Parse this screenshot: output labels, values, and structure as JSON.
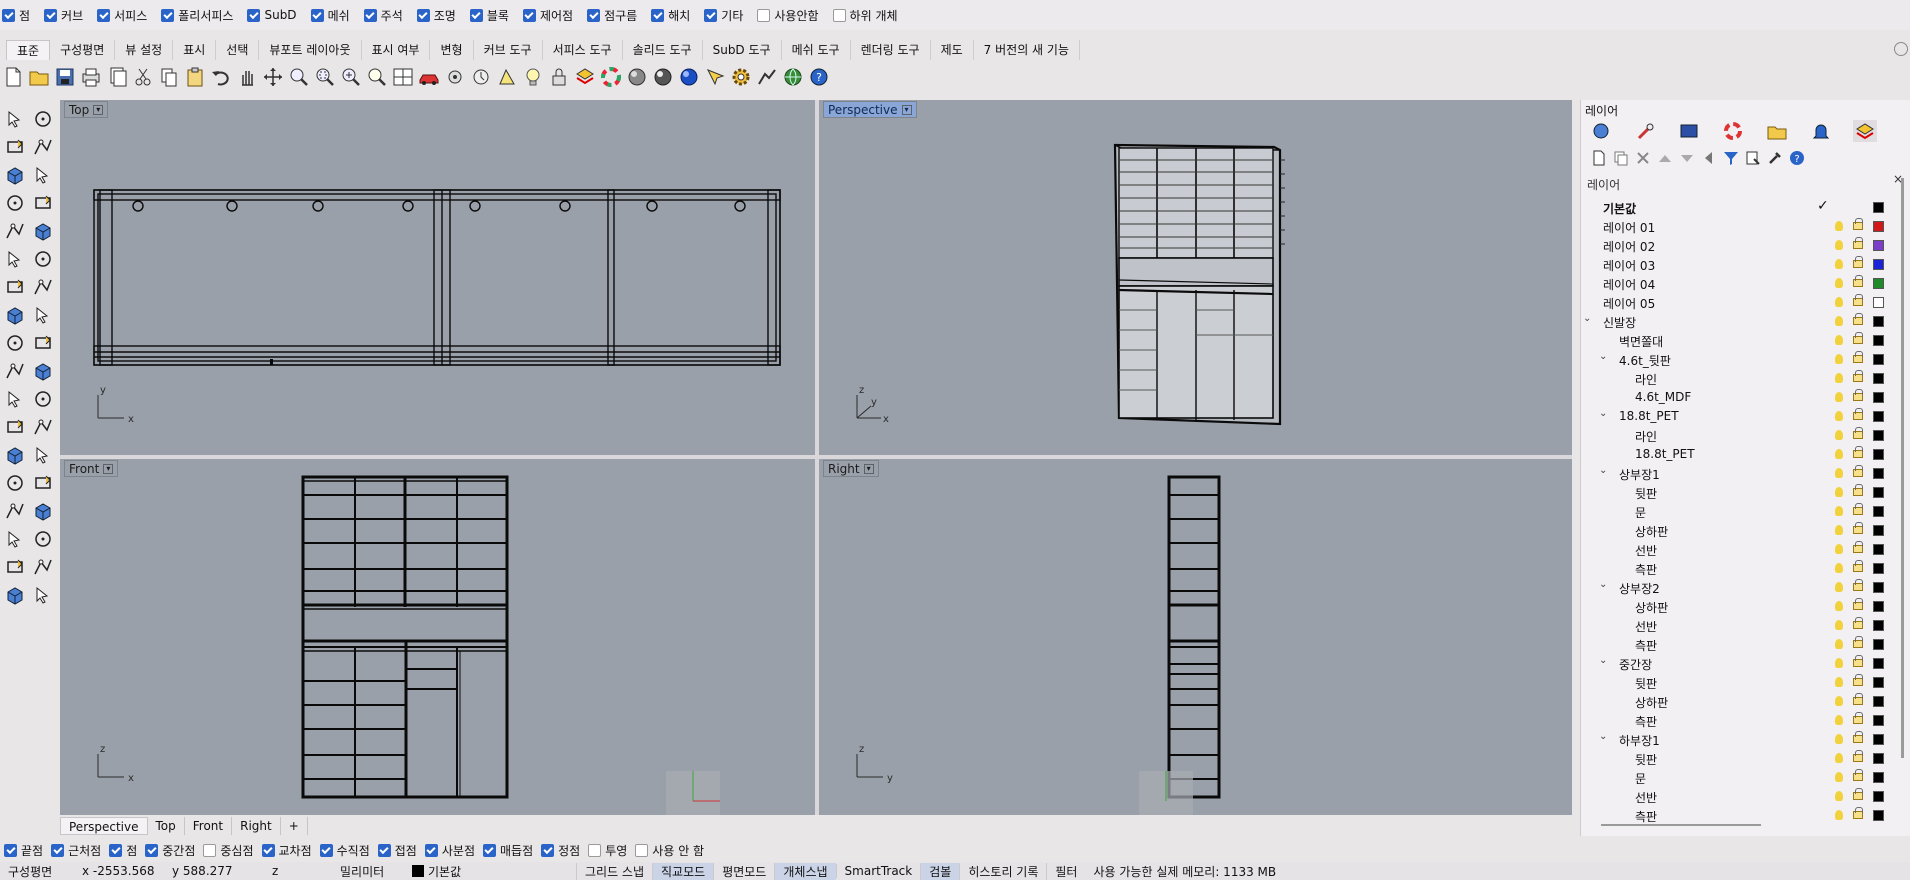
{
  "filters": [
    {
      "label": "점",
      "on": true
    },
    {
      "label": "커브",
      "on": true
    },
    {
      "label": "서피스",
      "on": true
    },
    {
      "label": "폴리서피스",
      "on": true
    },
    {
      "label": "SubD",
      "on": true
    },
    {
      "label": "메쉬",
      "on": true
    },
    {
      "label": "주석",
      "on": true
    },
    {
      "label": "조명",
      "on": true
    },
    {
      "label": "블록",
      "on": true
    },
    {
      "label": "제어점",
      "on": true
    },
    {
      "label": "점구름",
      "on": true
    },
    {
      "label": "해치",
      "on": true
    },
    {
      "label": "기타",
      "on": true
    },
    {
      "label": "사용안함",
      "on": false
    },
    {
      "label": "하위 개체",
      "on": false
    }
  ],
  "tabs": [
    "표준",
    "구성평면",
    "뷰 설정",
    "표시",
    "선택",
    "뷰포트 레이아웃",
    "표시 여부",
    "변형",
    "커브 도구",
    "서피스 도구",
    "솔리드 도구",
    "SubD 도구",
    "메쉬 도구",
    "렌더링 도구",
    "제도",
    "7 버전의 새 기능"
  ],
  "viewports": {
    "top": {
      "label": "Top"
    },
    "perspective": {
      "label": "Perspective"
    },
    "front": {
      "label": "Front"
    },
    "right": {
      "label": "Right"
    }
  },
  "axes": {
    "x": "x",
    "y": "y",
    "z": "z"
  },
  "viewport_tabs": [
    "Perspective",
    "Top",
    "Front",
    "Right",
    "+"
  ],
  "layer_panel": {
    "title": "레이어",
    "header": "레이어",
    "rows": [
      {
        "name": "기본값",
        "indent": 1,
        "bold": true,
        "current": true,
        "color": "#000000",
        "caret": ""
      },
      {
        "name": "레이어 01",
        "indent": 1,
        "color": "#d01818",
        "caret": ""
      },
      {
        "name": "레이어 02",
        "indent": 1,
        "color": "#7a3ec8",
        "caret": ""
      },
      {
        "name": "레이어 03",
        "indent": 1,
        "color": "#1c22d8",
        "caret": ""
      },
      {
        "name": "레이어 04",
        "indent": 1,
        "color": "#1e8a2a",
        "caret": ""
      },
      {
        "name": "레이어 05",
        "indent": 1,
        "color": "#ffffff",
        "caret": ""
      },
      {
        "name": "신발장",
        "indent": 1,
        "color": "#000000",
        "caret": "v"
      },
      {
        "name": "벽면쫄대",
        "indent": 2,
        "color": "#000000",
        "caret": ""
      },
      {
        "name": "4.6t_뒷판",
        "indent": 2,
        "color": "#000000",
        "caret": "v"
      },
      {
        "name": "라인",
        "indent": 3,
        "color": "#000000",
        "caret": ""
      },
      {
        "name": "4.6t_MDF",
        "indent": 3,
        "color": "#000000",
        "caret": ""
      },
      {
        "name": "18.8t_PET",
        "indent": 2,
        "color": "#000000",
        "caret": "v"
      },
      {
        "name": "라인",
        "indent": 3,
        "color": "#000000",
        "caret": ""
      },
      {
        "name": "18.8t_PET",
        "indent": 3,
        "color": "#000000",
        "caret": ""
      },
      {
        "name": "상부장1",
        "indent": 2,
        "color": "#000000",
        "caret": "v"
      },
      {
        "name": "뒷판",
        "indent": 3,
        "color": "#000000",
        "caret": ""
      },
      {
        "name": "문",
        "indent": 3,
        "color": "#000000",
        "caret": ""
      },
      {
        "name": "상하판",
        "indent": 3,
        "color": "#000000",
        "caret": ""
      },
      {
        "name": "선반",
        "indent": 3,
        "color": "#000000",
        "caret": ""
      },
      {
        "name": "측판",
        "indent": 3,
        "color": "#000000",
        "caret": ""
      },
      {
        "name": "상부장2",
        "indent": 2,
        "color": "#000000",
        "caret": "v"
      },
      {
        "name": "상하판",
        "indent": 3,
        "color": "#000000",
        "caret": ""
      },
      {
        "name": "선반",
        "indent": 3,
        "color": "#000000",
        "caret": ""
      },
      {
        "name": "측판",
        "indent": 3,
        "color": "#000000",
        "caret": ""
      },
      {
        "name": "중간장",
        "indent": 2,
        "color": "#000000",
        "caret": "v"
      },
      {
        "name": "뒷판",
        "indent": 3,
        "color": "#000000",
        "caret": ""
      },
      {
        "name": "상하판",
        "indent": 3,
        "color": "#000000",
        "caret": ""
      },
      {
        "name": "측판",
        "indent": 3,
        "color": "#000000",
        "caret": ""
      },
      {
        "name": "하부장1",
        "indent": 2,
        "color": "#000000",
        "caret": "v"
      },
      {
        "name": "뒷판",
        "indent": 3,
        "color": "#000000",
        "caret": ""
      },
      {
        "name": "문",
        "indent": 3,
        "color": "#000000",
        "caret": ""
      },
      {
        "name": "선반",
        "indent": 3,
        "color": "#000000",
        "caret": ""
      },
      {
        "name": "측판",
        "indent": 3,
        "color": "#000000",
        "caret": ""
      }
    ]
  },
  "osnaps": [
    {
      "label": "끝점",
      "on": true
    },
    {
      "label": "근처점",
      "on": true
    },
    {
      "label": "점",
      "on": true
    },
    {
      "label": "중간점",
      "on": true
    },
    {
      "label": "중심점",
      "on": false
    },
    {
      "label": "교차점",
      "on": true
    },
    {
      "label": "수직점",
      "on": true
    },
    {
      "label": "접점",
      "on": true
    },
    {
      "label": "사분점",
      "on": true
    },
    {
      "label": "매듭점",
      "on": true
    },
    {
      "label": "정점",
      "on": true
    },
    {
      "label": "투영",
      "on": false
    },
    {
      "label": "사용 안 함",
      "on": false
    }
  ],
  "status": {
    "cplane": "구성평면",
    "x": "x -2553.568",
    "y": "y 588.277",
    "z": "z",
    "units": "밀리미터",
    "layer": "기본값",
    "toggles": [
      {
        "label": "그리드 스냅",
        "pressed": false
      },
      {
        "label": "직교모드",
        "pressed": true
      },
      {
        "label": "평면모드",
        "pressed": false
      },
      {
        "label": "개체스냅",
        "pressed": true
      },
      {
        "label": "SmartTrack",
        "pressed": false
      },
      {
        "label": "검볼",
        "pressed": true
      },
      {
        "label": "히스토리 기록",
        "pressed": false
      },
      {
        "label": "필터",
        "pressed": false
      }
    ],
    "memory": "사용 가능한 실제 메모리: 1133 MB"
  }
}
